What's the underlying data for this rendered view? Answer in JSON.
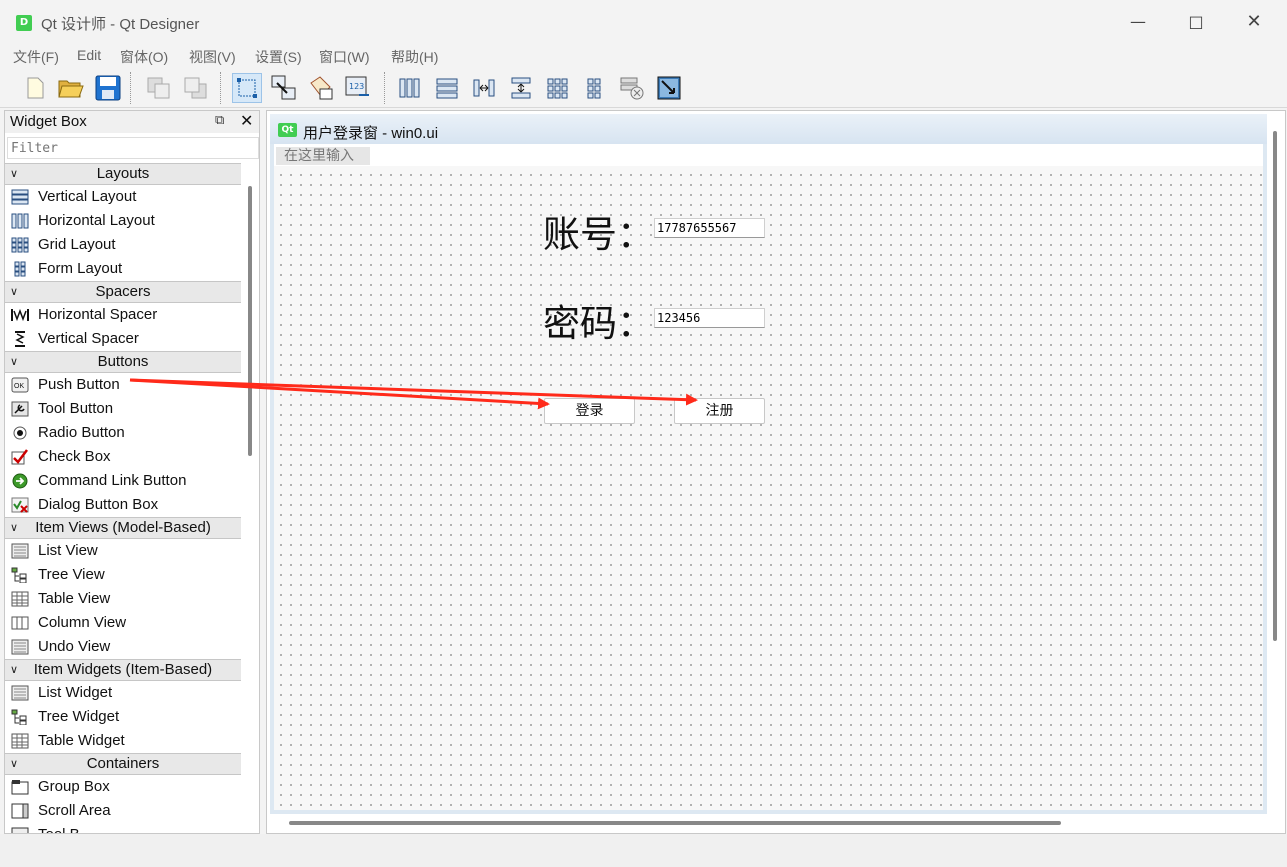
{
  "window": {
    "title": "Qt 设计师 - Qt Designer",
    "logo": "D"
  },
  "menu": [
    "文件(F)",
    "Edit",
    "窗体(O)",
    "视图(V)",
    "设置(S)",
    "窗口(W)",
    "帮助(H)"
  ],
  "widget_box": {
    "title": "Widget Box",
    "filter_placeholder": "Filter",
    "categories": [
      {
        "name": "Layouts",
        "items": [
          "Vertical Layout",
          "Horizontal Layout",
          "Grid Layout",
          "Form Layout"
        ]
      },
      {
        "name": "Spacers",
        "items": [
          "Horizontal Spacer",
          "Vertical Spacer"
        ]
      },
      {
        "name": "Buttons",
        "items": [
          "Push Button",
          "Tool Button",
          "Radio Button",
          "Check Box",
          "Command Link Button",
          "Dialog Button Box"
        ]
      },
      {
        "name": "Item Views (Model-Based)",
        "items": [
          "List View",
          "Tree View",
          "Table View",
          "Column View",
          "Undo View"
        ]
      },
      {
        "name": "Item Widgets (Item-Based)",
        "items": [
          "List Widget",
          "Tree Widget",
          "Table Widget"
        ]
      },
      {
        "name": "Containers",
        "items": [
          "Group Box",
          "Scroll Area",
          "Tool B..."
        ]
      }
    ]
  },
  "form": {
    "qt_icon": "Qt",
    "title": "用户登录窗 - win0.ui",
    "type_here": "在这里输入",
    "account_label": "账号：",
    "account_value": "17787655567",
    "password_label": "密码：",
    "password_value": "123456",
    "login_button": "登录",
    "register_button": "注册"
  },
  "colors": {
    "qt_green": "#41cd52",
    "arrow_red": "#ff2a1a",
    "active_tool_bg": "#d6e8f8"
  }
}
